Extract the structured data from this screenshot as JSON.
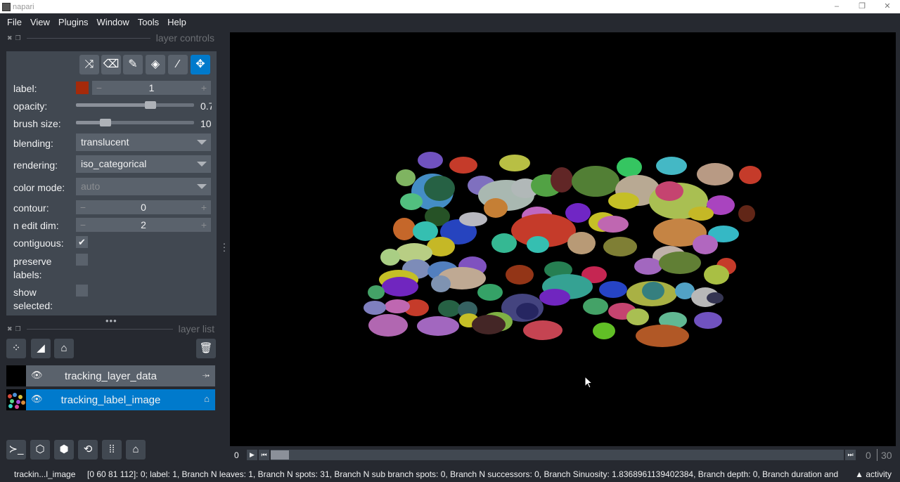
{
  "window": {
    "title": "napari",
    "controls": [
      "–",
      "❐",
      "✕"
    ]
  },
  "menu": [
    "File",
    "View",
    "Plugins",
    "Window",
    "Tools",
    "Help"
  ],
  "layer_controls": {
    "header": "layer controls",
    "tools": [
      "shuffle-icon",
      "erase-icon",
      "paint-icon",
      "fill-icon",
      "picker-icon",
      "pan-zoom-icon"
    ],
    "label": {
      "name": "label:",
      "value": "1",
      "color": "#a52a0a"
    },
    "opacity": {
      "name": "opacity:",
      "value": "0.70",
      "level": 0.7
    },
    "brush_size": {
      "name": "brush size:",
      "value": "10",
      "level": 0.25
    },
    "blending": {
      "name": "blending:",
      "value": "translucent"
    },
    "rendering": {
      "name": "rendering:",
      "value": "iso_categorical"
    },
    "color_mode": {
      "name": "color mode:",
      "value": "auto"
    },
    "contour": {
      "name": "contour:",
      "value": "0"
    },
    "n_edit_dim": {
      "name": "n edit dim:",
      "value": "2"
    },
    "contiguous": {
      "name": "contiguous:",
      "checked": true
    },
    "preserve_labels": {
      "name": "preserve labels:",
      "checked": false
    },
    "show_selected": {
      "name": "show selected:",
      "checked": false
    }
  },
  "layer_list": {
    "header": "layer list",
    "layers": [
      {
        "name": "tracking_layer_data",
        "type_icon": "tracks-icon",
        "selected": false
      },
      {
        "name": "tracking_label_image",
        "type_icon": "labels-icon",
        "selected": true
      }
    ]
  },
  "dims": {
    "axis_label": "0",
    "current": "0",
    "total": "30"
  },
  "status": {
    "layer": "trackin...l_image",
    "info": "[0 60 81 112]: 0; label: 1, Branch N leaves: 1, Branch N spots: 31, Branch N sub branch spots: 0, Branch N successors: 0, Branch Sinuosity: 1.8368961139402384, Branch depth: 0, Branch duration and displac",
    "activity": "▲ activity"
  }
}
